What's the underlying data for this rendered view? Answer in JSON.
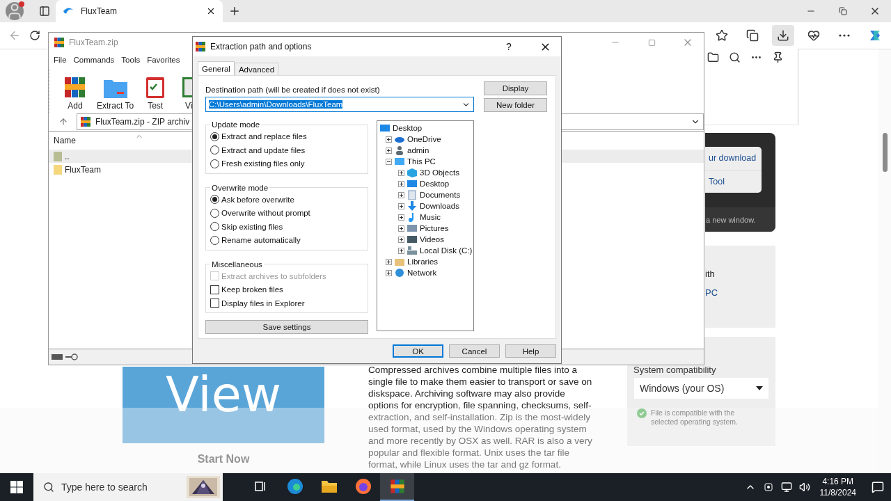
{
  "browser": {
    "tabs": [
      {
        "title": "FluxTeam",
        "selected": true
      }
    ]
  },
  "page": {
    "view_button": "View",
    "start_button": "Start Now",
    "description": [
      "Compressed archives combine multiple files into a",
      "single file to make them easier to transport or save on",
      "diskspace. Archiving software may also provide",
      "options for encryption, file spanning, checksums, self-",
      "extraction, and self-installation. Zip is the most-widely",
      "used format, used by the Windows operating system",
      "and more recently by OSX as well. RAR is also a very",
      "popular and flexible format. Unix uses the tar file",
      "format, while Linux uses the tar and gz format."
    ],
    "side_card": {
      "links": [
        "ur download",
        "Tool"
      ],
      "note": "a new window."
    },
    "info_card": {
      "text": "ith",
      "link": "PC"
    },
    "compatibility": {
      "title": "System compatibility",
      "select": "Windows (your OS)",
      "note": "File is compatible with the selected operating system."
    }
  },
  "winrar": {
    "title": "FluxTeam.zip",
    "menu": [
      "File",
      "Commands",
      "Tools",
      "Favorites"
    ],
    "toolbar": [
      {
        "label": "Add",
        "kind": "books"
      },
      {
        "label": "Extract To",
        "kind": "folder"
      },
      {
        "label": "Test",
        "kind": "clipboard"
      },
      {
        "label": "Vi",
        "kind": "book"
      }
    ],
    "address": "FluxTeam.zip - ZIP archiv",
    "columns": [
      "Name"
    ],
    "rows": [
      {
        "name": "..",
        "kind": "parent",
        "selected": true
      },
      {
        "name": "FluxTeam",
        "kind": "folder",
        "selected": false
      }
    ]
  },
  "dialog": {
    "title": "Extraction path and options",
    "help": "?",
    "tabs": [
      {
        "label": "General",
        "selected": true
      },
      {
        "label": "Advanced",
        "selected": false
      }
    ],
    "destination_label": "Destination path (will be created if does not exist)",
    "destination_value": "C:\\Users\\admin\\Downloads\\FluxTeam",
    "destination_highlighted": true,
    "side_buttons": [
      "Display",
      "New folder"
    ],
    "groups": [
      {
        "title": "Update mode",
        "options": [
          {
            "label": "Extract and replace files",
            "kind": "radio",
            "checked": true,
            "disabled": false
          },
          {
            "label": "Extract and update files",
            "kind": "radio",
            "checked": false,
            "disabled": false
          },
          {
            "label": "Fresh existing files only",
            "kind": "radio",
            "checked": false,
            "disabled": false
          }
        ]
      },
      {
        "title": "Overwrite mode",
        "options": [
          {
            "label": "Ask before overwrite",
            "kind": "radio",
            "checked": true,
            "disabled": false
          },
          {
            "label": "Overwrite without prompt",
            "kind": "radio",
            "checked": false,
            "disabled": false
          },
          {
            "label": "Skip existing files",
            "kind": "radio",
            "checked": false,
            "disabled": false
          },
          {
            "label": "Rename automatically",
            "kind": "radio",
            "checked": false,
            "disabled": false
          }
        ]
      },
      {
        "title": "Miscellaneous",
        "options": [
          {
            "label": "Extract archives to subfolders",
            "kind": "checkbox",
            "checked": false,
            "disabled": true
          },
          {
            "label": "Keep broken files",
            "kind": "checkbox",
            "checked": false,
            "disabled": false
          },
          {
            "label": "Display files in Explorer",
            "kind": "checkbox",
            "checked": false,
            "disabled": false
          }
        ]
      }
    ],
    "save_button": "Save settings",
    "tree": {
      "label": "Desktop",
      "kind": "desktop",
      "children": [
        {
          "label": "OneDrive",
          "kind": "cloud",
          "expanded": false
        },
        {
          "label": "admin",
          "kind": "user",
          "expanded": false
        },
        {
          "label": "This PC",
          "kind": "computer",
          "expanded": true,
          "children": [
            {
              "label": "3D Objects",
              "kind": "cube",
              "expanded": false
            },
            {
              "label": "Desktop",
              "kind": "desktop",
              "expanded": false
            },
            {
              "label": "Documents",
              "kind": "documents",
              "expanded": false
            },
            {
              "label": "Downloads",
              "kind": "downloads",
              "expanded": false
            },
            {
              "label": "Music",
              "kind": "music",
              "expanded": false
            },
            {
              "label": "Pictures",
              "kind": "pictures",
              "expanded": false
            },
            {
              "label": "Videos",
              "kind": "videos",
              "expanded": false
            },
            {
              "label": "Local Disk (C:)",
              "kind": "disk",
              "expanded": false
            }
          ]
        },
        {
          "label": "Libraries",
          "kind": "libraries",
          "expanded": false
        },
        {
          "label": "Network",
          "kind": "network",
          "expanded": false
        }
      ]
    },
    "buttons": [
      {
        "label": "OK",
        "default": true
      },
      {
        "label": "Cancel",
        "default": false
      },
      {
        "label": "Help",
        "default": false
      }
    ]
  },
  "taskbar": {
    "search_placeholder": "Type here to search",
    "apps": [
      {
        "kind": "taskview",
        "selected": false
      },
      {
        "kind": "edge",
        "selected": false
      },
      {
        "kind": "explorer",
        "selected": false
      },
      {
        "kind": "firefox",
        "selected": false
      },
      {
        "kind": "winrar",
        "selected": true
      }
    ],
    "time": "4:16 PM",
    "date": "11/8/2024"
  }
}
